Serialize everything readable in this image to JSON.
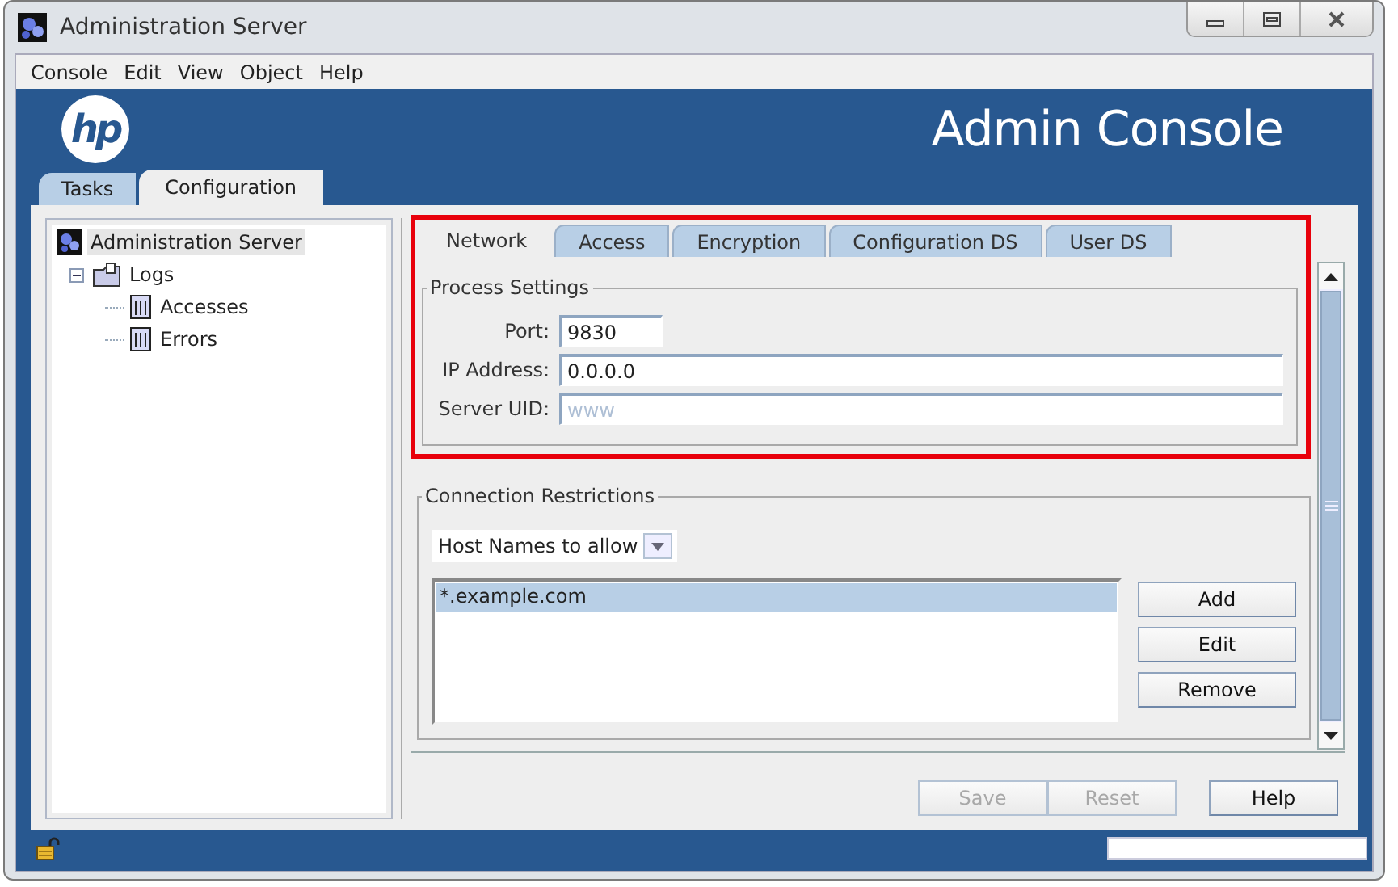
{
  "window": {
    "title": "Administration Server"
  },
  "menu": [
    "Console",
    "Edit",
    "View",
    "Object",
    "Help"
  ],
  "header": {
    "logo": "hp",
    "title": "Admin Console"
  },
  "main_tabs": [
    {
      "label": "Tasks",
      "selected": false
    },
    {
      "label": "Configuration",
      "selected": true
    }
  ],
  "tree": [
    {
      "label": "Administration Server",
      "selected": true,
      "kind": "server",
      "children": [
        {
          "label": "Logs",
          "selected": false,
          "kind": "folder",
          "expanded": true,
          "children": [
            {
              "label": "Accesses",
              "selected": false,
              "kind": "log"
            },
            {
              "label": "Errors",
              "selected": false,
              "kind": "log"
            }
          ]
        }
      ]
    }
  ],
  "settings_tabs": [
    {
      "label": "Network",
      "selected": true
    },
    {
      "label": "Access",
      "selected": false
    },
    {
      "label": "Encryption",
      "selected": false
    },
    {
      "label": "Configuration DS",
      "selected": false
    },
    {
      "label": "User DS",
      "selected": false
    }
  ],
  "process_settings": {
    "title": "Process Settings",
    "fields": [
      {
        "label": "Port:",
        "value": "9830",
        "disabled": false
      },
      {
        "label": "IP Address:",
        "value": "0.0.0.0",
        "disabled": false
      },
      {
        "label": "Server UID:",
        "value": "www",
        "disabled": true
      }
    ]
  },
  "connection_restrictions": {
    "title": "Connection Restrictions",
    "dropdown": "Host Names to allow",
    "hosts": [
      {
        "label": "*.example.com",
        "selected": true
      }
    ],
    "buttons": [
      "Add",
      "Edit",
      "Remove"
    ]
  },
  "footer_buttons": [
    {
      "label": "Save",
      "disabled": true
    },
    {
      "label": "Reset",
      "disabled": true
    },
    {
      "label": "Help",
      "disabled": false
    }
  ]
}
